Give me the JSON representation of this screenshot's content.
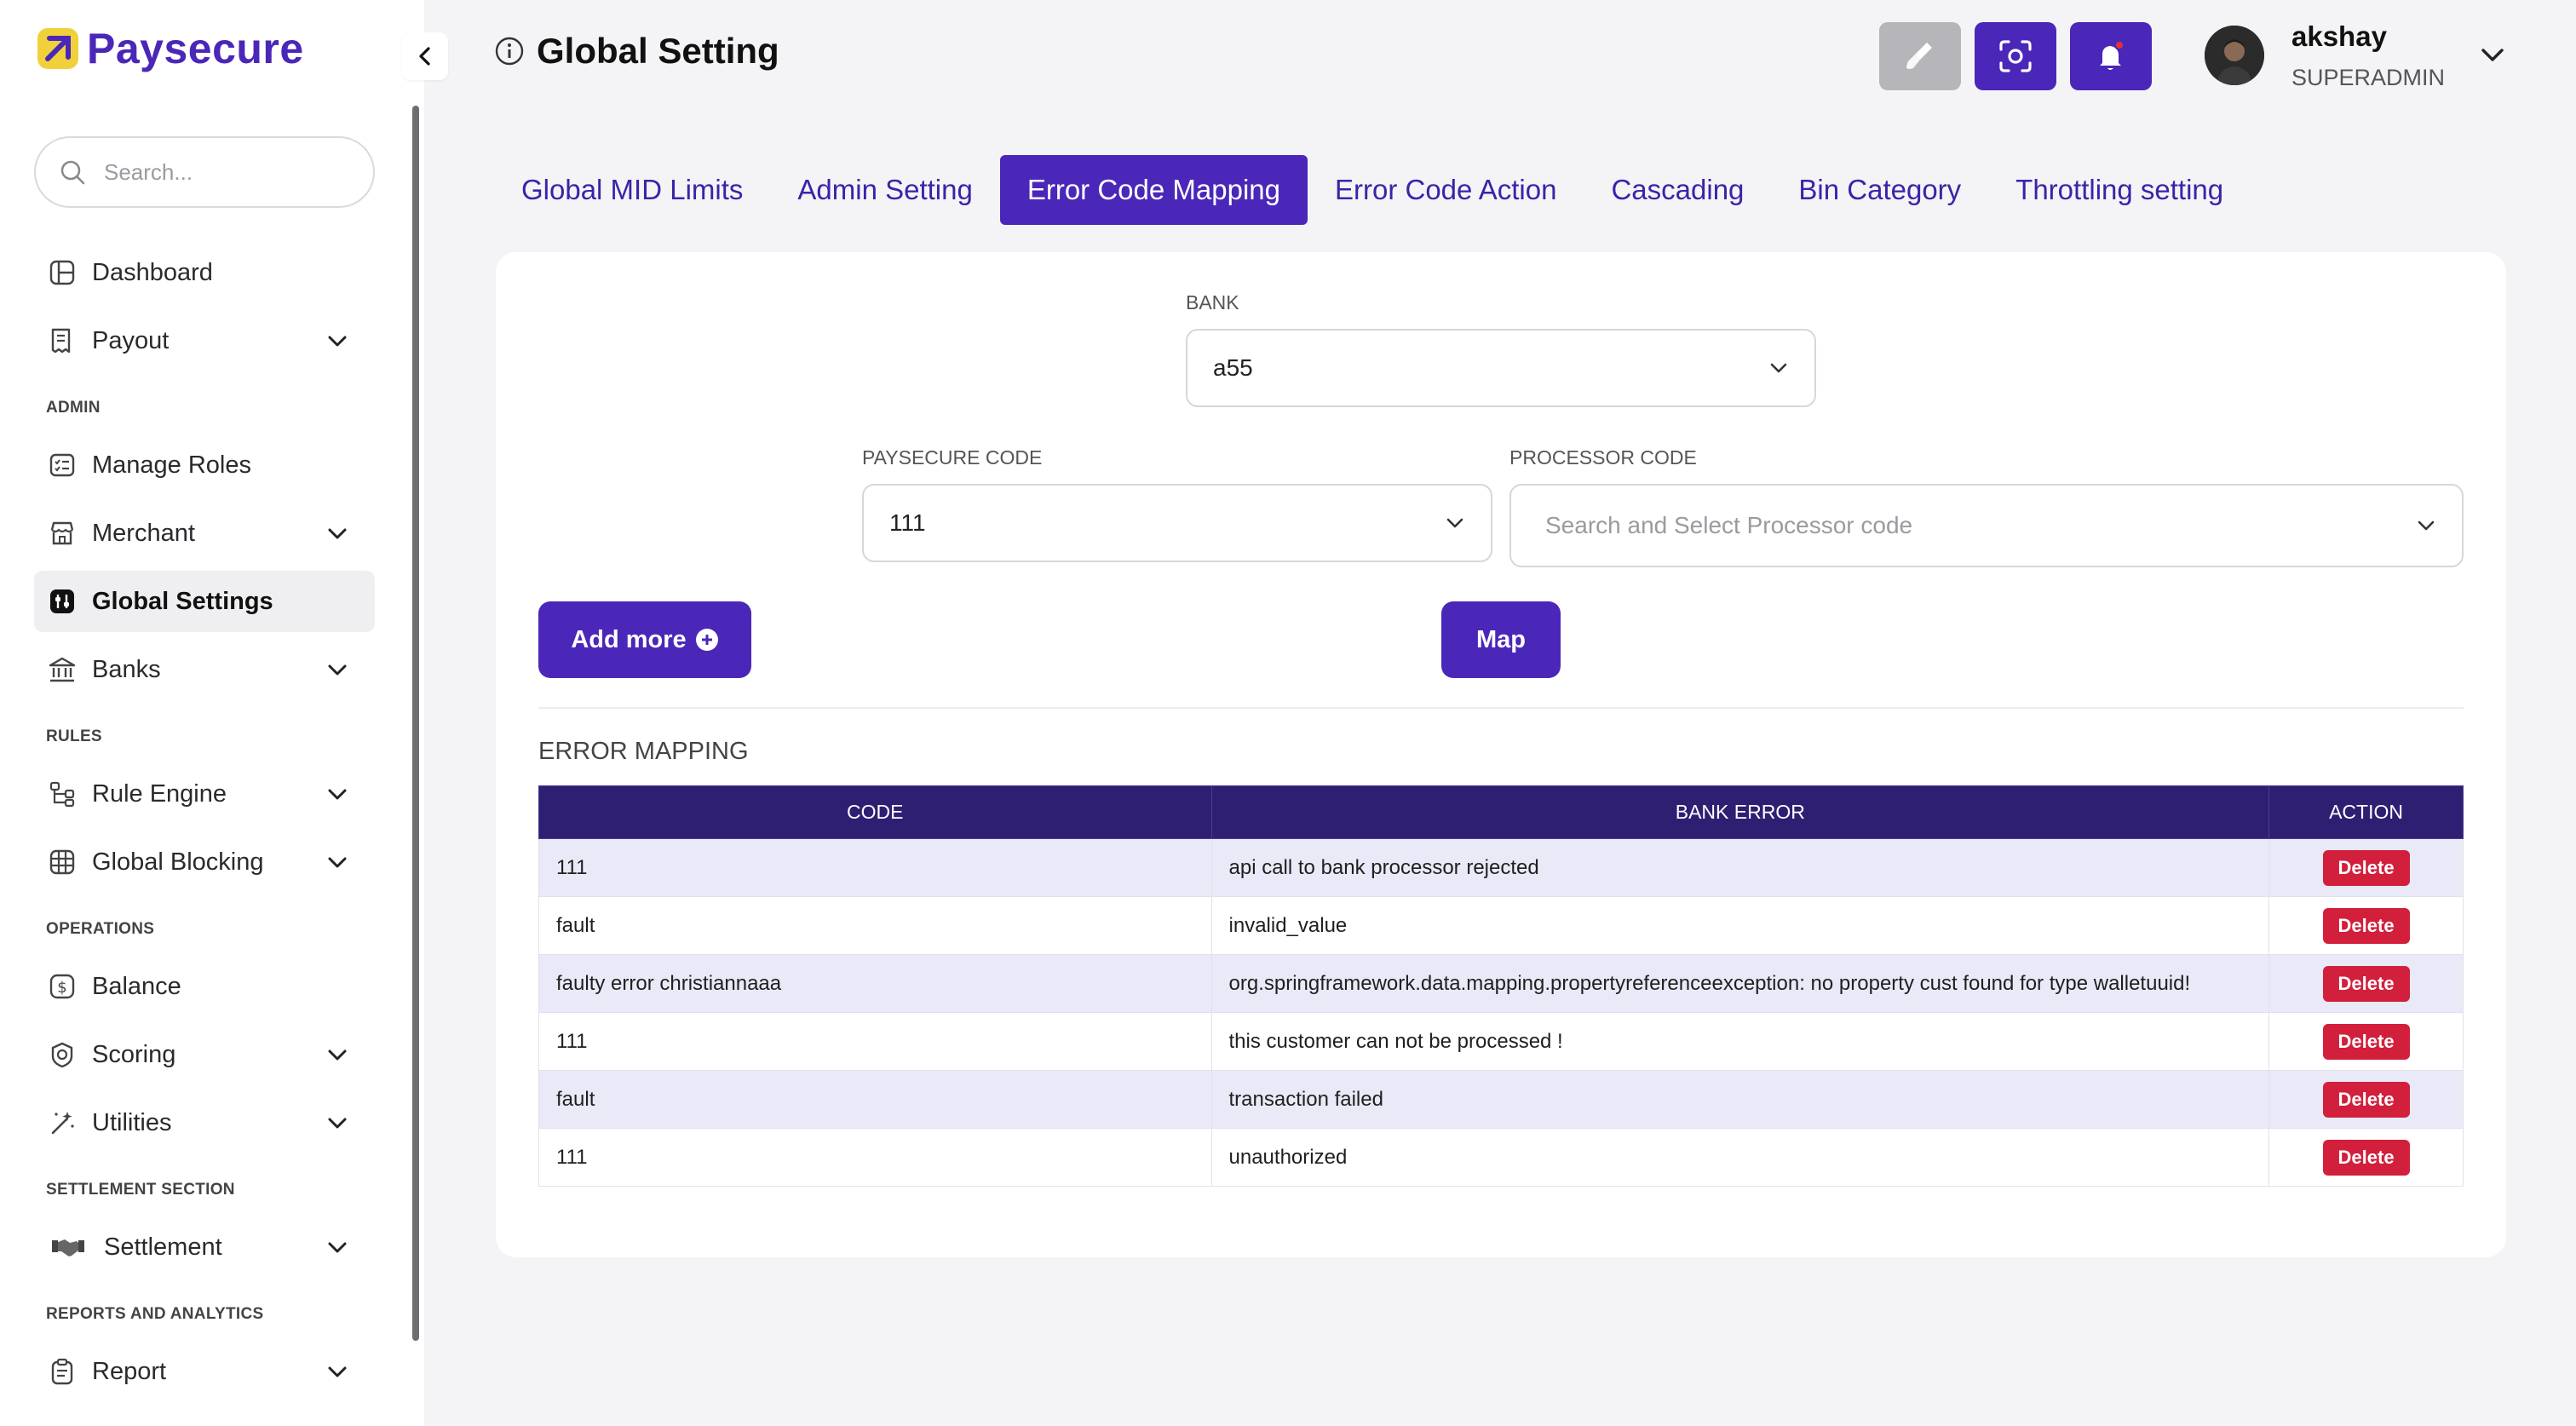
{
  "brand": {
    "name": "Paysecure"
  },
  "search": {
    "placeholder": "Search..."
  },
  "sidebar": {
    "items": [
      {
        "label": "Dashboard"
      },
      {
        "label": "Payout"
      },
      {
        "label": "Manage Roles"
      },
      {
        "label": "Merchant"
      },
      {
        "label": "Global Settings"
      },
      {
        "label": "Banks"
      },
      {
        "label": "Rule Engine"
      },
      {
        "label": "Global Blocking"
      },
      {
        "label": "Balance"
      },
      {
        "label": "Scoring"
      },
      {
        "label": "Utilities"
      },
      {
        "label": "Settlement"
      },
      {
        "label": "Report"
      }
    ],
    "sections": [
      "ADMIN",
      "RULES",
      "OPERATIONS",
      "SETTLEMENT SECTION",
      "REPORTS AND ANALYTICS"
    ]
  },
  "header": {
    "title": "Global Setting",
    "user": {
      "name": "akshay",
      "role": "SUPERADMIN"
    }
  },
  "tabs": [
    {
      "label": "Global MID Limits"
    },
    {
      "label": "Admin Setting"
    },
    {
      "label": "Error Code Mapping"
    },
    {
      "label": "Error Code Action"
    },
    {
      "label": "Cascading"
    },
    {
      "label": "Bin Category"
    },
    {
      "label": "Throttling setting"
    }
  ],
  "form": {
    "bank_label": "BANK",
    "bank_value": "a55",
    "paysecure_code_label": "PAYSECURE CODE",
    "paysecure_code_value": "111",
    "processor_code_label": "PROCESSOR CODE",
    "processor_code_placeholder": "Search and Select Processor code",
    "add_more_label": "Add more",
    "map_label": "Map"
  },
  "mapping": {
    "title": "ERROR MAPPING",
    "columns": [
      "CODE",
      "BANK ERROR",
      "ACTION"
    ],
    "delete_label": "Delete",
    "rows": [
      {
        "code": "111",
        "bank_error": "api call to bank processor rejected"
      },
      {
        "code": "fault",
        "bank_error": "invalid_value"
      },
      {
        "code": "faulty error christiannaaa",
        "bank_error": "org.springframework.data.mapping.propertyreferenceexception: no property cust found for type walletuuid!"
      },
      {
        "code": "111",
        "bank_error": "this customer can not be processed !"
      },
      {
        "code": "fault",
        "bank_error": "transaction failed"
      },
      {
        "code": "111",
        "bank_error": "unauthorized"
      }
    ]
  },
  "colors": {
    "accent": "#4a27b8",
    "table_header": "#2f1f72",
    "danger": "#d21f3c",
    "logo_mark": "#f0d13b"
  }
}
